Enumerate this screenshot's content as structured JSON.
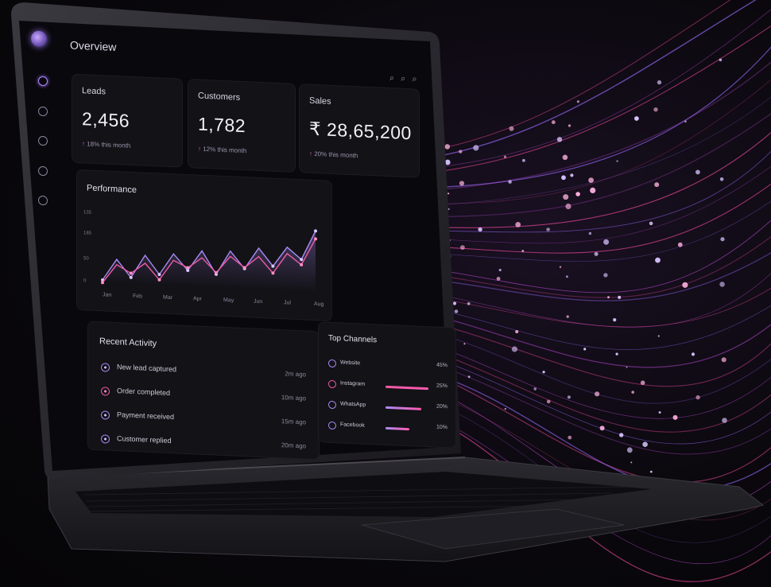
{
  "app": {
    "page_title": "Overview",
    "top_icons": [
      "search-icon",
      "search-icon",
      "search-icon"
    ]
  },
  "colors": {
    "accent_purple": "#a98bf5",
    "accent_pink": "#ef5aa5"
  },
  "kpis": [
    {
      "label": "Leads",
      "value": "2,456",
      "delta": "18% this month"
    },
    {
      "label": "Customers",
      "value": "1,782",
      "delta": "12% this month"
    },
    {
      "label": "Sales",
      "value": "₹ 28,65,200",
      "delta": "20% this month"
    }
  ],
  "performance": {
    "title": "Performance",
    "y_ticks": [
      "135",
      "185",
      "50",
      "0"
    ],
    "x_ticks": [
      "Jan",
      "Feb",
      "Mar",
      "Apr",
      "May",
      "Jun",
      "Jul",
      "Aug"
    ]
  },
  "chart_data": {
    "type": "line",
    "title": "Performance",
    "categories": [
      "Jan",
      "Feb",
      "Mar",
      "Apr",
      "May",
      "Jun",
      "Jul",
      "Aug"
    ],
    "series": [
      {
        "values": [
          5,
          45,
          12,
          55,
          20,
          60,
          30,
          68,
          25,
          70,
          38,
          78,
          45,
          82,
          60,
          115
        ]
      },
      {
        "values": [
          0,
          35,
          20,
          40,
          10,
          48,
          35,
          55,
          28,
          60,
          40,
          62,
          32,
          70,
          50,
          100
        ]
      }
    ],
    "ylim": [
      0,
      135
    ]
  },
  "activity": {
    "title": "Recent Activity",
    "items": [
      {
        "text": "New lead captured",
        "time": "2m ago",
        "tone": "purple"
      },
      {
        "text": "Order completed",
        "time": "10m ago",
        "tone": "pink"
      },
      {
        "text": "Payment received",
        "time": "15m ago",
        "tone": "purple"
      },
      {
        "text": "Customer replied",
        "time": "20m ago",
        "tone": "purple"
      }
    ]
  },
  "channels": {
    "title": "Top Channels",
    "items": [
      {
        "name": "Website",
        "pct": "45%",
        "share": 0,
        "tone": "purple"
      },
      {
        "name": "Instagram",
        "pct": "25%",
        "share": 0.9,
        "tone": "pink"
      },
      {
        "name": "WhatsApp",
        "pct": "20%",
        "share": 0.75,
        "tone": "purple"
      },
      {
        "name": "Facebook",
        "pct": "10%",
        "share": 0.5,
        "tone": "purple"
      }
    ]
  }
}
